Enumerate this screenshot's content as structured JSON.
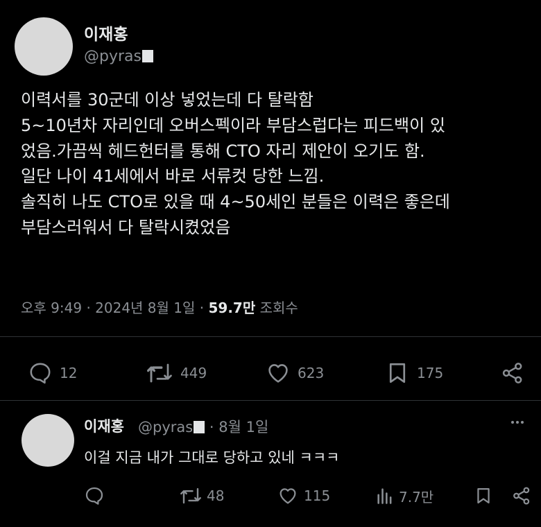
{
  "tweet": {
    "author_name": "이재홍",
    "handle": "@pyras",
    "body_lines": [
      "이력서를 30군데 이상 넣었는데 다 탈락함",
      "5~10년차 자리인데 오버스펙이라 부담스럽다는 피드백이 있",
      "었음.가끔씩 헤드헌터를 통해 CTO 자리 제안이 오기도 함.",
      "일단 나이 41세에서 바로 서류컷 당한 느낌.",
      "솔직히 나도 CTO로 있을 때 4~50세인 분들은 이력은 좋은데",
      "부담스러워서 다 탈락시켰었음"
    ],
    "time": "오후 9:49",
    "date": "2024년 8월 1일",
    "views": "59.7만",
    "views_label": "조회수",
    "actions": {
      "replies": "12",
      "retweets": "449",
      "likes": "623",
      "bookmarks": "175"
    }
  },
  "reply": {
    "author_name": "이재홍",
    "handle": "@pyras",
    "date": "8월 1일",
    "text": "이걸 지금 내가 그대로 당하고 있네 ㅋㅋㅋ",
    "actions": {
      "retweets": "48",
      "likes": "115",
      "views": "7.7만"
    }
  },
  "colors": {
    "background": "#000000",
    "text": "#e7e9ea",
    "secondary": "#8b8f94",
    "divider": "#2f3336"
  }
}
